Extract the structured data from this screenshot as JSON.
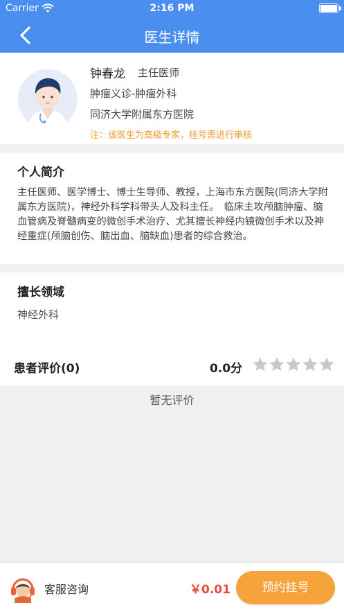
{
  "status_bar": {
    "carrier": "Carrier",
    "time": "2:16 PM"
  },
  "nav": {
    "title": "医生详情",
    "back_icon": "chevron-left-icon"
  },
  "doctor": {
    "name": "钟春龙",
    "title": "主任医师",
    "department": "肿瘤义诊-肿瘤外科",
    "hospital": "同济大学附属东方医院",
    "note": "注：该医生为高级专家，挂号需进行审核"
  },
  "intro": {
    "heading": "个人简介",
    "text": "主任医师、医学博士、博士生导师、教授，上海市东方医院(同济大学附属东方医院)，神经外科学科带头人及科主任。　临床主攻颅脑肿瘤、脑血管病及脊髓病变的微创手术治疗、尤其擅长神经内镜微创手术以及神经重症(颅脑创伤、脑出血、脑缺血)患者的综合救治。"
  },
  "specialty": {
    "heading": "擅长领域",
    "text": "神经外科"
  },
  "reviews": {
    "heading": "患者评价(0)",
    "score": "0.0分",
    "rating": 0,
    "max_rating": 5,
    "empty_text": "暂无评价"
  },
  "bottom_bar": {
    "service_label": "客服咨询",
    "price": "￥0.01",
    "book_label": "预约挂号"
  },
  "colors": {
    "primary": "#4a8ef0",
    "accent": "#f6a33c",
    "note": "#f39a2c",
    "price": "#e84b3c",
    "star_empty": "#c8c8c8"
  }
}
